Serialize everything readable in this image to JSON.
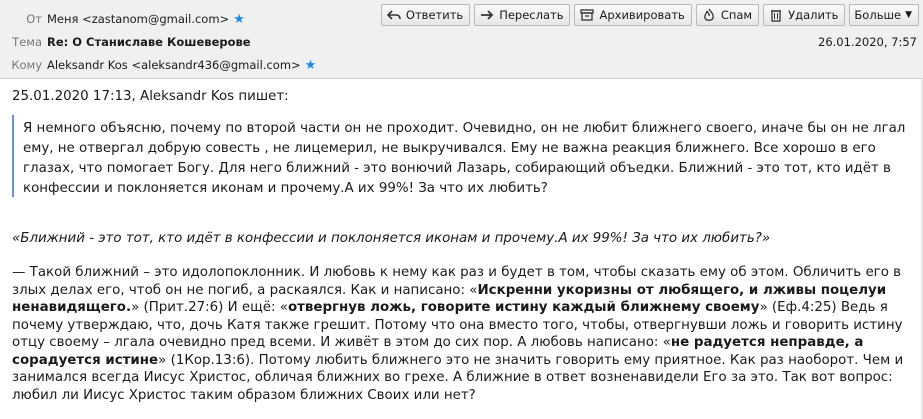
{
  "header": {
    "from_label": "От",
    "from_value": "Меня <zastanom@gmail.com>",
    "subject_label": "Тема",
    "subject_value": "Re: О Станиславе Кошеверове",
    "to_label": "Кому",
    "to_value": "Aleksandr Kos <aleksandr436@gmail.com>",
    "date": "26.01.2020, 7:57"
  },
  "toolbar": {
    "reply": "Ответить",
    "forward": "Переслать",
    "archive": "Архивировать",
    "spam": "Спам",
    "delete": "Удалить",
    "more": "Больше"
  },
  "message": {
    "attribution": "25.01.2020 17:13, Aleksandr Kos пишет:",
    "quote": "Я немного объясню, почему по второй части он не проходит. Очевидно, он не любит ближнего своего, иначе бы он не лгал ему, не отвергал добрую совесть , не лицемерил, не выкручивался. Ему не важна реакция ближнего. Все хорошо в его глазах, что помогает Богу. Для него ближний - это вонючий Лазарь, собирающий объедки. Ближний - это тот, кто идёт в конфессии и поклоняется иконам и прочему.А их 99%! За что их любить?",
    "italic_quote": "«Ближний - это тот, кто идёт в конфессии и поклоняется иконам и прочему.А их 99%! За что их любить?»",
    "reply_parts": [
      "— Такой ближний – это идолопоклонник. И любовь к нему как раз и будет в том, чтобы сказать ему об этом. Обличить его в злых делах его, чтоб он не погиб, а раскаялся. Как и написано: «",
      "Искренни укоризны от любящего, и лживы поцелуи ненавидящего.",
      "» (Прит.27:6) И ещё: «",
      "отвергнув ложь, говорите истину каждый ближнему своему",
      "» (Еф.4:25) Ведь я почему утверждаю, что, дочь Катя также грешит. Потому что она вместо того, чтобы, отвергнувши ложь и говорить истину отцу своему – лгала очевидно пред всеми. И живёт в этом до сих пор. А любовь написано: «",
      "не радуется неправде, а сорадуется истине",
      "» (1Кор.13:6). Потому любить ближнего это не значить говорить ему приятное. Как раз наоборот. Чем и занимался всегда Иисус Христос, обличая ближних во грехе. А ближние в ответ возненавидели Его за это. Так вот вопрос: любил ли Иисус Христос таким образом ближних Своих или нет?"
    ]
  },
  "colors": {
    "star": "#1e88e5",
    "quote_bar": "#6a8fd8",
    "header_bg": "#f0f0f0"
  },
  "icons": [
    "reply-icon",
    "forward-icon",
    "archive-icon",
    "spam-icon",
    "delete-icon",
    "chevron-down-icon",
    "star-icon"
  ]
}
